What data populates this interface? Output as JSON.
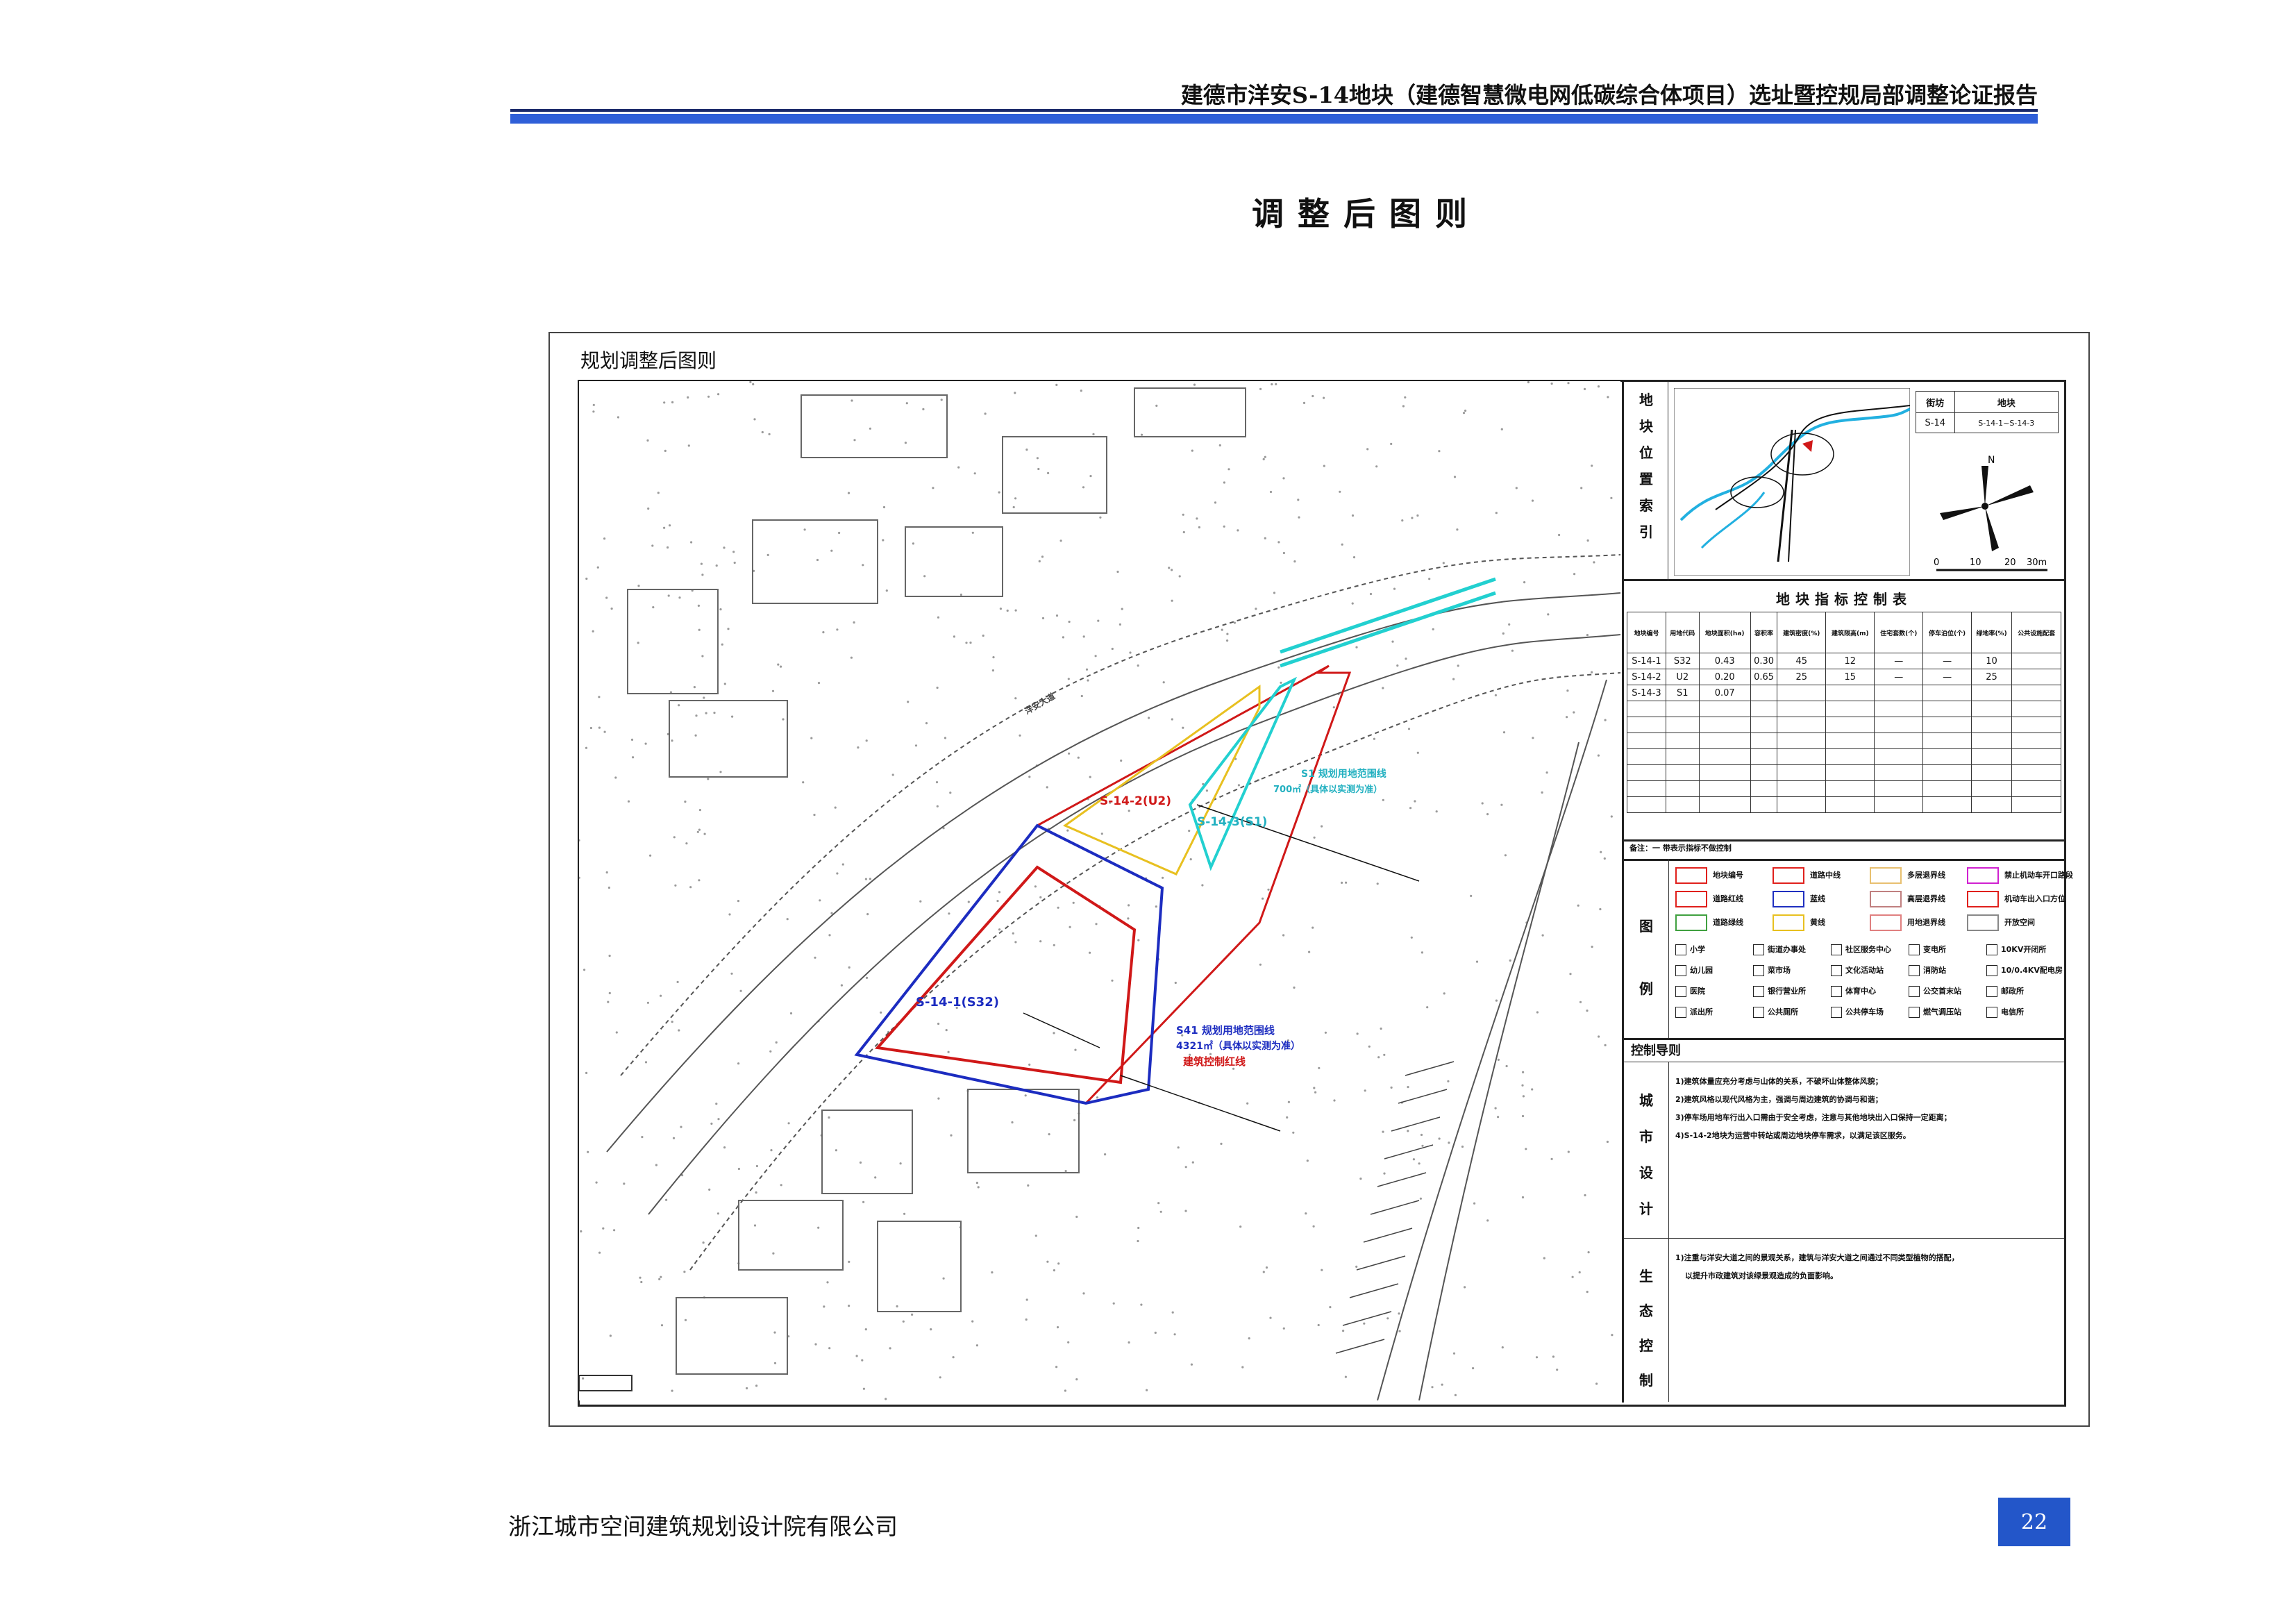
{
  "header": {
    "title": "建德市洋安S-14地块（建德智慧微电网低碳综合体项目）选址暨控规局部调整论证报告"
  },
  "page_heading": "调整后图则",
  "sheet": {
    "title": "规划调整后图则",
    "location_index_label": [
      "地",
      "块",
      "位",
      "置",
      "索",
      "引"
    ],
    "block_table": {
      "header_district": "街坊",
      "header_parcel": "地块",
      "district": "S-14",
      "parcels": "S-14-1~S-14-3"
    },
    "scale": {
      "ticks": [
        "0",
        "10",
        "20",
        "30m"
      ]
    },
    "north": "N",
    "indicator_table": {
      "title": "地块指标控制表",
      "columns": [
        "地块编号",
        "用地代码",
        "地块面积(ha)",
        "容积率",
        "建筑密度(%)",
        "建筑限高(m)",
        "住宅套数(个)",
        "停车泊位(个)",
        "绿地率(%)",
        "公共设施配套"
      ],
      "rows": [
        [
          "S-14-1",
          "S32",
          "0.43",
          "0.30",
          "45",
          "12",
          "—",
          "—",
          "10",
          ""
        ],
        [
          "S-14-2",
          "U2",
          "0.20",
          "0.65",
          "25",
          "15",
          "—",
          "—",
          "25",
          ""
        ],
        [
          "S-14-3",
          "S1",
          "0.07",
          "",
          "",
          "",
          "",
          "",
          "",
          ""
        ]
      ],
      "note": "备注：一 带表示指标不做控制"
    },
    "legend_label": [
      "图",
      "例"
    ],
    "legend": [
      {
        "label": "地块编号",
        "color": "#e0201c"
      },
      {
        "label": "道路中线",
        "color": "#e0201c"
      },
      {
        "label": "多层退界线",
        "color": "#e8c070"
      },
      {
        "label": "禁止机动车开口路段",
        "color": "#d020d0"
      },
      {
        "label": "道路红线",
        "color": "#e0201c"
      },
      {
        "label": "蓝线",
        "color": "#2030c0"
      },
      {
        "label": "高层退界线",
        "color": "#c08080"
      },
      {
        "label": "机动车出入口方位",
        "color": "#e0201c"
      },
      {
        "label": "道路绿线",
        "color": "#40a040"
      },
      {
        "label": "黄线",
        "color": "#e8c020"
      },
      {
        "label": "用地退界线",
        "color": "#e08080"
      },
      {
        "label": "开放空间",
        "color": "#888888"
      }
    ],
    "legend_icons": [
      "小学",
      "街道办事处",
      "社区服务中心",
      "变电所",
      "10KV开闭所",
      "幼儿园",
      "菜市场",
      "文化活动站",
      "消防站",
      "10/0.4KV配电房",
      "医院",
      "银行营业所",
      "体育中心",
      "公交首末站",
      "邮政所",
      "派出所",
      "公共厕所",
      "公共停车场",
      "燃气调压站",
      "电信所"
    ],
    "control_label": "控制导则",
    "urban_design_label": [
      "城",
      "市",
      "设",
      "计"
    ],
    "urban_design_rules": [
      "1)建筑体量应充分考虑与山体的关系，不破坏山体整体风貌；",
      "2)建筑风格以现代风格为主，强调与周边建筑的协调与和谐；",
      "3)停车场用地车行出入口需由于安全考虑，注意与其他地块出入口保持一定距离；",
      "4)S-14-2地块为运营中转站或周边地块停车需求，以满足该区服务。"
    ],
    "ecology_label": [
      "生",
      "态",
      "控",
      "制"
    ],
    "ecology_rules": [
      "1)注重与洋安大道之间的景观关系，建筑与洋安大道之间通过不同类型植物的搭配，",
      "以提升市政建筑对该绿景观造成的负面影响。"
    ],
    "map_labels": {
      "parcel_1": "S-14-1(S32)",
      "parcel_2": "S-14-2(U2)",
      "parcel_3": "S-14-3(S1)",
      "s41_boundary": "S41 规划用地范围线",
      "s41_area": "4321㎡（具体以实测为准）",
      "building_redline": "建筑控制红线",
      "s1_boundary": "S1 规划用地范围线",
      "s1_area": "700㎡（具体以实测为准）",
      "road": "洋安大道"
    }
  },
  "footer": {
    "company": "浙江城市空间建筑规划设计院有限公司",
    "page_number": "22"
  }
}
